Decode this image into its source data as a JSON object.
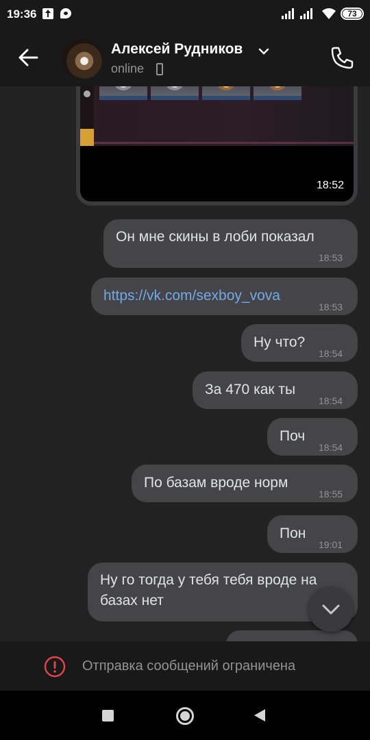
{
  "status_bar": {
    "time": "19:36",
    "battery": "73"
  },
  "header": {
    "contact_name": "Алексей Рудников",
    "contact_status": "online",
    "icons": [
      "back-arrow-icon",
      "chevron-down-icon",
      "mobile-device-icon",
      "phone-icon"
    ]
  },
  "chat": {
    "media_message": {
      "time": "18:52"
    },
    "messages": [
      {
        "text": "Он мне скины в лоби показал",
        "time": "18:53"
      },
      {
        "text": "https://vk.com/sexboy_vova",
        "time": "18:53",
        "is_link": true
      },
      {
        "text": "Ну что?",
        "time": "18:54"
      },
      {
        "text": "За 470 как ты",
        "time": "18:54"
      },
      {
        "text": "Поч",
        "time": "18:54"
      },
      {
        "text": "По базам вроде норм",
        "time": "18:55"
      },
      {
        "text": "Пон",
        "time": "19:01"
      },
      {
        "line1": "Ну го тогда у тебя тебя вроде на",
        "line2": "базах нет"
      }
    ]
  },
  "footer": {
    "restriction_text": "Отправка сообщений ограничена"
  },
  "colors": {
    "background": "#222223",
    "bubble": "#454547",
    "link": "#71aaeb",
    "warning": "#e64646",
    "secondary_text": "#939393"
  }
}
